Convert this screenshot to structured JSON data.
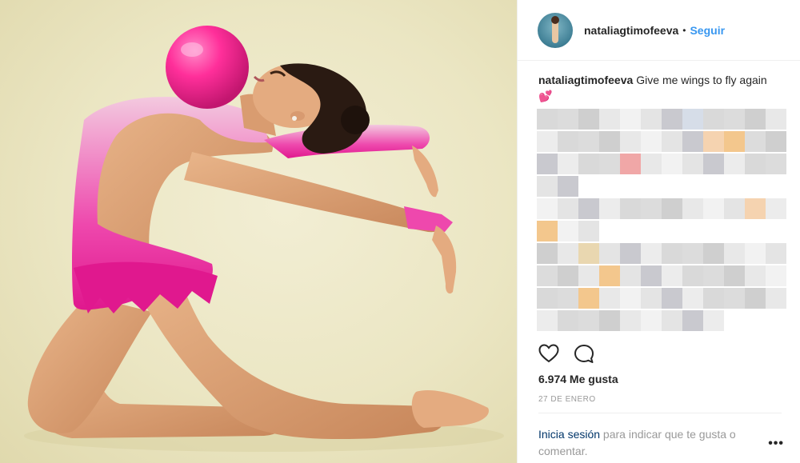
{
  "post": {
    "username": "nataliagtimofeeva",
    "separator": "•",
    "follow_label": "Seguir",
    "caption_user": "nataliagtimofeeva",
    "caption_text": "Give me wings to fly again",
    "caption_emoji": "💕",
    "likes": "6.974 Me gusta",
    "date": "27 DE ENERO",
    "login_link": "Inicia sesión",
    "login_rest": " para indicar que te gusta o comentar.",
    "more_label": "•••"
  },
  "icons": {
    "like": "heart-outline-icon",
    "comment": "comment-bubble-icon"
  },
  "colors": {
    "link_blue": "#3897f0",
    "login_dark_blue": "#003569",
    "leotard_pink": "#ec2d9a",
    "ball_pink": "#ff2f9a",
    "floor": "#ebe6c3"
  }
}
